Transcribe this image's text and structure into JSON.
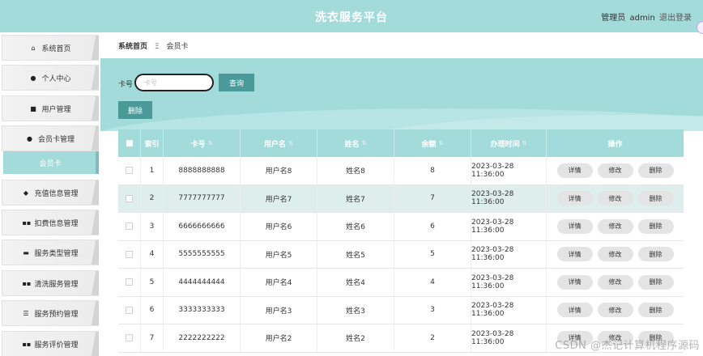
{
  "header": {
    "title": "洗衣服务平台",
    "user_role": "管理员",
    "username": "admin",
    "logout_label": "退出登录"
  },
  "sidebar": {
    "items": [
      {
        "label": "系统首页",
        "icon": "home-icon"
      },
      {
        "label": "个人中心",
        "icon": "user-icon"
      },
      {
        "label": "用户管理",
        "icon": "user-manage-icon"
      },
      {
        "label": "会员卡管理",
        "icon": "user-icon"
      },
      {
        "label": "会员卡",
        "icon": "",
        "active": true
      },
      {
        "label": "充值信息管理",
        "icon": "pin-icon"
      },
      {
        "label": "扣费信息管理",
        "icon": "grid-icon"
      },
      {
        "label": "服务类型管理",
        "icon": "monitor-icon"
      },
      {
        "label": "清洗服务管理",
        "icon": "grid-icon"
      },
      {
        "label": "服务预约管理",
        "icon": "sliders-icon"
      },
      {
        "label": "服务评价管理",
        "icon": "grid-icon"
      }
    ]
  },
  "breadcrumb": {
    "home": "系统首页",
    "separator": "Ξ",
    "current": "会员卡"
  },
  "search": {
    "label": "卡号",
    "placeholder": "卡号",
    "query_button": "查询",
    "delete_button": "删除"
  },
  "table": {
    "headers": [
      "索引",
      "卡号",
      "用户名",
      "姓名",
      "余额",
      "办理时间",
      "操作"
    ],
    "rows": [
      {
        "index": "1",
        "card": "8888888888",
        "username": "用户名8",
        "name": "姓名8",
        "balance": "8",
        "time": "2023-03-28 11:36:00"
      },
      {
        "index": "2",
        "card": "7777777777",
        "username": "用户名7",
        "name": "姓名7",
        "balance": "7",
        "time": "2023-03-28 11:36:00"
      },
      {
        "index": "3",
        "card": "6666666666",
        "username": "用户名6",
        "name": "姓名6",
        "balance": "6",
        "time": "2023-03-28 11:36:00"
      },
      {
        "index": "4",
        "card": "5555555555",
        "username": "用户名5",
        "name": "姓名5",
        "balance": "5",
        "time": "2023-03-28 11:36:00"
      },
      {
        "index": "5",
        "card": "4444444444",
        "username": "用户名4",
        "name": "姓名4",
        "balance": "4",
        "time": "2023-03-28 11:36:00"
      },
      {
        "index": "6",
        "card": "3333333333",
        "username": "用户名3",
        "name": "姓名3",
        "balance": "3",
        "time": "2023-03-28 11:36:00"
      },
      {
        "index": "7",
        "card": "2222222222",
        "username": "用户名2",
        "name": "姓名2",
        "balance": "2",
        "time": "2023-03-28 11:36:00"
      }
    ],
    "actions": {
      "detail": "详情",
      "edit": "修改",
      "delete": "删除"
    }
  },
  "watermark": "CSDN @杰记计算机程序源码",
  "colors": {
    "accent": "#a3dbdb",
    "button": "#4a9a9a",
    "row_highlight": "#ddeeed"
  }
}
